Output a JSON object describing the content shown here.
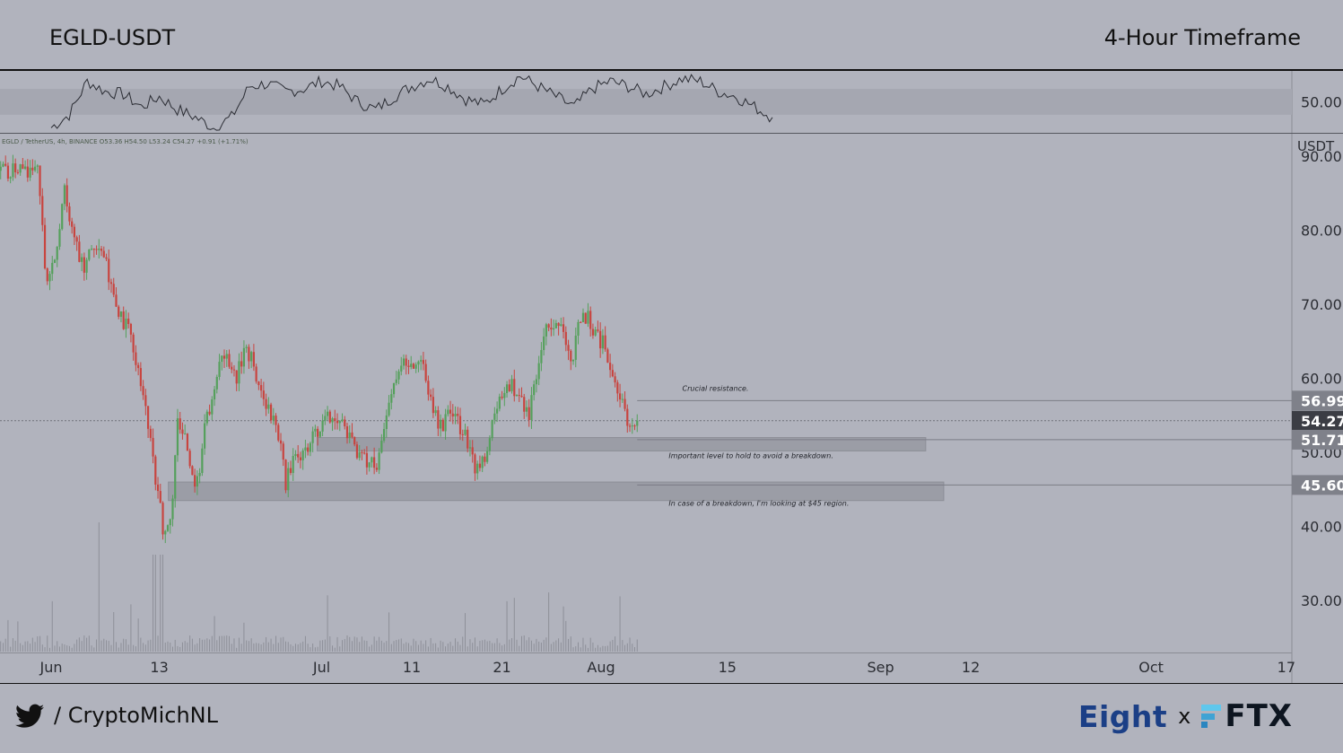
{
  "header": {
    "pair_title": "EGLD-USDT",
    "timeframe_title": "4-Hour Timeframe"
  },
  "footer": {
    "handle": "/ CryptoMichNL",
    "brand_eight": "Eight",
    "brand_x": "x",
    "brand_ftx": "FTX"
  },
  "colors": {
    "background": "#b1b3bd",
    "up_candle": "#55a05c",
    "down_candle": "#c8443f",
    "zone_fill": "#9b9da6",
    "price_tag": "#7f818a",
    "current_price_tag": "#3b3d44"
  },
  "chart_data": [
    {
      "type": "line",
      "panel": "indicator",
      "ylim": [
        38,
        62
      ],
      "band": [
        45,
        55
      ],
      "y_ticks": [
        50.0
      ],
      "y_tick_labels": [
        "50.00"
      ],
      "x": [
        0,
        2,
        4,
        6,
        8,
        10,
        12,
        14,
        16,
        18,
        20,
        22,
        24,
        26,
        28,
        30,
        32,
        34,
        36,
        38,
        40,
        42,
        44,
        46,
        48,
        50,
        52,
        54,
        56,
        58,
        60,
        62,
        64,
        66,
        68,
        70,
        72,
        74,
        76,
        78,
        80
      ],
      "values": [
        40,
        45,
        58,
        54,
        53,
        48,
        52,
        47,
        44,
        40,
        44,
        56,
        57,
        54,
        55,
        58,
        56,
        50,
        47,
        52,
        56,
        59,
        56,
        51,
        49,
        55,
        60,
        56,
        52,
        48,
        55,
        58,
        56,
        53,
        56,
        59,
        58,
        54,
        52,
        48,
        44
      ]
    },
    {
      "type": "candlestick",
      "panel": "price",
      "symbol_info": "EGLD / TetherUS, 4h, BINANCE  O53.36  H54.50  L53.24  C54.27  +0.91 (+1.71%)",
      "currency_label": "USDT",
      "ylim": [
        23,
        93
      ],
      "y_ticks": [
        30,
        40,
        50,
        60,
        70,
        80,
        90
      ],
      "y_tick_labels": [
        "30.00",
        "40.00",
        "50.00",
        "60.00",
        "70.00",
        "80.00",
        "90.00"
      ],
      "x_ticks": [
        {
          "label": "Jun",
          "day": 0
        },
        {
          "label": "13",
          "day": 12
        },
        {
          "label": "Jul",
          "day": 30
        },
        {
          "label": "11",
          "day": 40
        },
        {
          "label": "21",
          "day": 50
        },
        {
          "label": "Aug",
          "day": 61
        },
        {
          "label": "15",
          "day": 75
        },
        {
          "label": "Sep",
          "day": 92
        },
        {
          "label": "12",
          "day": 102
        },
        {
          "label": "Oct",
          "day": 122
        },
        {
          "label": "17",
          "day": 137
        }
      ],
      "close_path": [
        {
          "day": -1.5,
          "close": 88
        },
        {
          "day": -0.5,
          "close": 73
        },
        {
          "day": 0.5,
          "close": 77
        },
        {
          "day": 1.5,
          "close": 86
        },
        {
          "day": 2.5,
          "close": 79
        },
        {
          "day": 3.5,
          "close": 75
        },
        {
          "day": 4.5,
          "close": 77
        },
        {
          "day": 6,
          "close": 76
        },
        {
          "day": 7.5,
          "close": 69
        },
        {
          "day": 9,
          "close": 65
        },
        {
          "day": 10.5,
          "close": 56
        },
        {
          "day": 11.5,
          "close": 47
        },
        {
          "day": 12.5,
          "close": 39
        },
        {
          "day": 13.5,
          "close": 43
        },
        {
          "day": 14,
          "close": 55
        },
        {
          "day": 15,
          "close": 51
        },
        {
          "day": 16,
          "close": 44
        },
        {
          "day": 17,
          "close": 53
        },
        {
          "day": 18.5,
          "close": 61
        },
        {
          "day": 19.5,
          "close": 63
        },
        {
          "day": 20.5,
          "close": 60
        },
        {
          "day": 21.5,
          "close": 64
        },
        {
          "day": 22.5,
          "close": 62
        },
        {
          "day": 23.5,
          "close": 57
        },
        {
          "day": 24.5,
          "close": 55
        },
        {
          "day": 25.5,
          "close": 50
        },
        {
          "day": 26,
          "close": 46
        },
        {
          "day": 27,
          "close": 50
        },
        {
          "day": 28,
          "close": 49
        },
        {
          "day": 29,
          "close": 52
        },
        {
          "day": 30,
          "close": 54
        },
        {
          "day": 31.5,
          "close": 55
        },
        {
          "day": 33,
          "close": 52
        },
        {
          "day": 34,
          "close": 50
        },
        {
          "day": 35,
          "close": 49
        },
        {
          "day": 36,
          "close": 48
        },
        {
          "day": 37,
          "close": 53
        },
        {
          "day": 38,
          "close": 59
        },
        {
          "day": 39,
          "close": 62
        },
        {
          "day": 40,
          "close": 61
        },
        {
          "day": 41,
          "close": 62
        },
        {
          "day": 42,
          "close": 58
        },
        {
          "day": 43,
          "close": 53
        },
        {
          "day": 44,
          "close": 55
        },
        {
          "day": 45,
          "close": 54
        },
        {
          "day": 46,
          "close": 52
        },
        {
          "day": 47,
          "close": 48
        },
        {
          "day": 48,
          "close": 49
        },
        {
          "day": 49,
          "close": 55
        },
        {
          "day": 50,
          "close": 58
        },
        {
          "day": 51,
          "close": 59
        },
        {
          "day": 52,
          "close": 57
        },
        {
          "day": 53,
          "close": 55
        },
        {
          "day": 54,
          "close": 62
        },
        {
          "day": 55,
          "close": 67
        },
        {
          "day": 56,
          "close": 68
        },
        {
          "day": 57,
          "close": 66
        },
        {
          "day": 58,
          "close": 62
        },
        {
          "day": 58.5,
          "close": 69
        },
        {
          "day": 59.5,
          "close": 68
        },
        {
          "day": 60.5,
          "close": 66
        },
        {
          "day": 61.5,
          "close": 64
        },
        {
          "day": 62.5,
          "close": 60
        },
        {
          "day": 63,
          "close": 58
        },
        {
          "day": 64,
          "close": 54
        },
        {
          "day": 65,
          "close": 54.27
        }
      ],
      "candle_count": 260,
      "vertical_lines": [
        {
          "label": "Crucial resistance.",
          "price": 56.99
        },
        {
          "label": "Important level to hold to avoid a breakdown.",
          "price": 51.71
        },
        {
          "label": "In case of a breakdown, I'm looking at $45 region.",
          "price": 45.6
        }
      ],
      "zones": [
        {
          "from_day": 29.5,
          "to_day": 97,
          "low": 50.2,
          "high": 52.0
        },
        {
          "from_day": 13,
          "to_day": 99,
          "low": 43.5,
          "high": 46.0
        }
      ],
      "price_tags": [
        {
          "label": "56.99",
          "value": 56.99
        },
        {
          "label": "54.27",
          "value": 54.27,
          "current": true
        },
        {
          "label": "51.71",
          "value": 51.71
        },
        {
          "label": "45.60",
          "value": 45.6
        }
      ],
      "annotations": [
        {
          "text": "Crucial resistance.",
          "day": 70,
          "price": 58.3
        },
        {
          "text": "Important level to hold to avoid a breakdown.",
          "day": 68.5,
          "price": 49.2
        },
        {
          "text": "In case of a breakdown, I'm looking at $45 region.",
          "day": 68.5,
          "price": 42.8
        }
      ]
    }
  ]
}
